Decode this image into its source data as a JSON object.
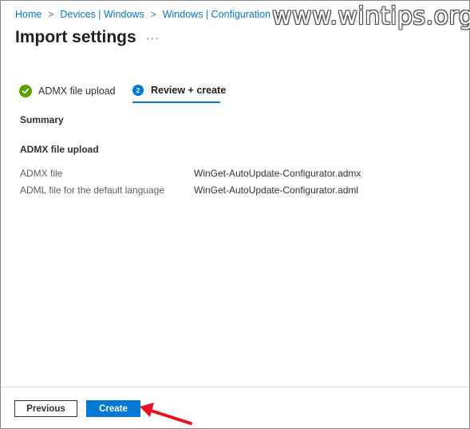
{
  "breadcrumb": {
    "items": [
      "Home",
      "Devices | Windows",
      "Windows | Configuration"
    ],
    "separator": ">"
  },
  "watermark": "www.wintips.org",
  "page": {
    "title": "Import settings",
    "more": "···"
  },
  "steps": [
    {
      "label": "ADMX file upload",
      "state": "completed",
      "icon": "check-icon"
    },
    {
      "label": "Review + create",
      "number": "2",
      "state": "active"
    }
  ],
  "summary_label": "Summary",
  "section": {
    "title": "ADMX file upload",
    "rows": [
      {
        "label": "ADMX file",
        "value": "WinGet-AutoUpdate-Configurator.admx"
      },
      {
        "label": "ADML file for the default language",
        "value": "WinGet-AutoUpdate-Configurator.adml"
      }
    ]
  },
  "footer": {
    "previous_label": "Previous",
    "create_label": "Create"
  },
  "colors": {
    "accent": "#0078d4",
    "success": "#57a300",
    "annotation_arrow": "#e81123"
  }
}
